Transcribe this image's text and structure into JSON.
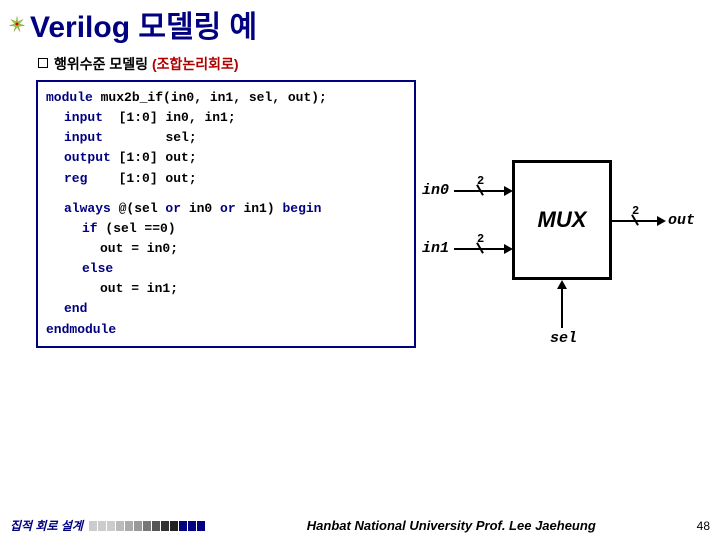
{
  "title": "Verilog 모델링 예",
  "subhead": {
    "prefix": "행위수준 모델링 ",
    "suffix": "(조합논리회로)"
  },
  "code": {
    "l1": {
      "k": "module",
      "r": " mux2b_if(in0, in1, sel, out);"
    },
    "l2": {
      "k": "input",
      "t": "  [1:0] ",
      "r": "in0, in1;"
    },
    "l3": {
      "k": "input",
      "t": "        ",
      "r": "sel;"
    },
    "l4": {
      "k": "output",
      "t": " [1:0] ",
      "r": "out;"
    },
    "l5": {
      "k": "reg",
      "t": "    [1:0] ",
      "r": "out;"
    },
    "l6": {
      "k1": "always",
      "m": " @(sel ",
      "k2": "or",
      "m2": " in0 ",
      "k3": "or",
      "m3": " in1) ",
      "k4": "begin"
    },
    "l7": {
      "k": "if",
      "r": " (sel ==0)"
    },
    "l8": "out = in0;",
    "l9": {
      "k": "else"
    },
    "l10": "out = in1;",
    "l11": {
      "k": "end"
    },
    "l12": {
      "k": "endmodule"
    }
  },
  "diagram": {
    "box": "MUX",
    "in0": "in0",
    "in1": "in1",
    "sel": "sel",
    "out": "out",
    "bus": "2"
  },
  "footer": {
    "left": "집적 회로 설계",
    "center": "Hanbat National University Prof. Lee Jaeheung",
    "page": "48"
  },
  "bar_colors": [
    "#ccc",
    "#ccc",
    "#ccc",
    "#bbb",
    "#aaa",
    "#999",
    "#777",
    "#555",
    "#333",
    "#222",
    "#000080",
    "#000080",
    "#000080"
  ]
}
